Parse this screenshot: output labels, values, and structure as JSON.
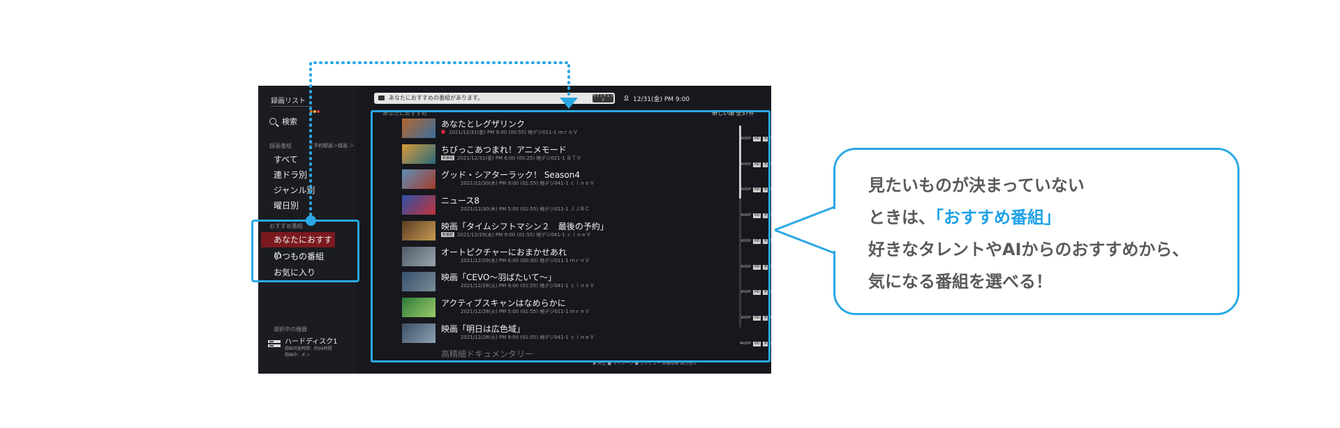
{
  "colors": {
    "accent": "#2aa8e5",
    "selected_row": "#7a1a1f",
    "callout_accent": "#1fa2e8",
    "screen_bg": "#17181d"
  },
  "sidebar": {
    "title": "録画リスト",
    "search_label": "検索",
    "recorded_section": "録画番組",
    "filter_chip": "＜予約録画＞録画 ＞",
    "items": [
      {
        "label": "すべて"
      },
      {
        "label": "連ドラ別"
      },
      {
        "label": "ジャンル別"
      },
      {
        "label": "曜日別"
      }
    ],
    "recommend_section": "おすすめ番組",
    "recommend_items": [
      {
        "label": "あなたにおすすめ",
        "selected": true
      },
      {
        "label": "いつもの番組"
      },
      {
        "label": "お気に入り"
      }
    ],
    "device_section": "選択中の機器",
    "device_name": "ハードディスク1",
    "device_sub1": "録画可能時間：約99時間",
    "device_sub2": "録画中：オン"
  },
  "header": {
    "notice": "あなたにおすすめの番組があります。",
    "notice_button": "今すぐチェック",
    "datetime": "12/31(金) PM 9:00"
  },
  "list": {
    "label": "あなたにおすすめ",
    "sort": "新しい順 全37件",
    "rows": [
      {
        "title": "あなたとレグザリンク",
        "info": "2021/12/31(金) PM 9:00 (00:55) 地デジ011-1 ｍｒｎＶ",
        "recording": true,
        "thumb_a": "#b5662d",
        "thumb_b": "#3b6f9e"
      },
      {
        "title": "ちびっこあつまれ！アニメモード",
        "info": "2021/12/31(金) PM 6:00 (00:25) 地デジ021-1 ＢＴＶ",
        "new": "新番組",
        "thumb_a": "#d79a3a",
        "thumb_b": "#2a6b7a"
      },
      {
        "title": "グッド・シアターラック！ Season4",
        "info": "2021/12/30(木) PM 9:00 (01:55) 地デジ041-1 ｃｉｎｅＶ",
        "thumb_a": "#5e8fb8",
        "thumb_b": "#a53b2a"
      },
      {
        "title": "ニュース8",
        "info": "2021/12/30(木) PM 5:00 (01:55) 地デジ011-1 ＪＪＢＣ",
        "thumb_a": "#2f4fa8",
        "thumb_b": "#c0363a"
      },
      {
        "title": "映画「タイムシフトマシン２　最後の予約」",
        "info": "2021/12/29(水) PM 9:00 (01:55) 地デジ041-1 ｃｉｎｅＶ",
        "new": "新番組",
        "thumb_a": "#5c3d24",
        "thumb_b": "#c79b52"
      },
      {
        "title": "オートピクチャーにおまかせあれ",
        "info": "2021/12/29(水) PM 6:00 (00:30) 地デジ011-1 ｍｒｎＶ",
        "thumb_a": "#4d5a66",
        "thumb_b": "#9aa5ad"
      },
      {
        "title": "映画「CEVO～羽ばたいて～」",
        "info": "2021/12/28(火) PM 9:00 (01:55) 地デジ041-1 ｃｉｎｅＶ",
        "thumb_a": "#35506d",
        "thumb_b": "#7a8a95"
      },
      {
        "title": "アクティブスキャンはなめらかに",
        "info": "2021/12/28(火) PM 5:00 (01:55) 地デジ011-1 ｍｒｎＶ",
        "thumb_a": "#2e7a3a",
        "thumb_b": "#9acd6a"
      },
      {
        "title": "映画「明日は広色域」",
        "info": "2021/12/28(火) PM 9:00 (01:55) 地デジ041-1 ｃｉｎｅＶ",
        "thumb_a": "#3b4f66",
        "thumb_b": "#8fa2b3"
      }
    ],
    "flags": {
      "quality": "4K60P",
      "hd": "HD",
      "ja": "字",
      "ch": "SUBO"
    },
    "partial_row": "高精細ドキュメンタリー",
    "bottom_bar": "▶ 再生   ■ マイシーン   ● プレビュー      詳細情報   並び替え"
  },
  "callout": {
    "line1": "見たいものが決まっていない",
    "line2_prefix": "ときは、",
    "line2_accent": "「おすすめ番組」",
    "line3": "好きなタレントやAIからのおすすめから、",
    "line4": "気になる番組を選べる！"
  }
}
